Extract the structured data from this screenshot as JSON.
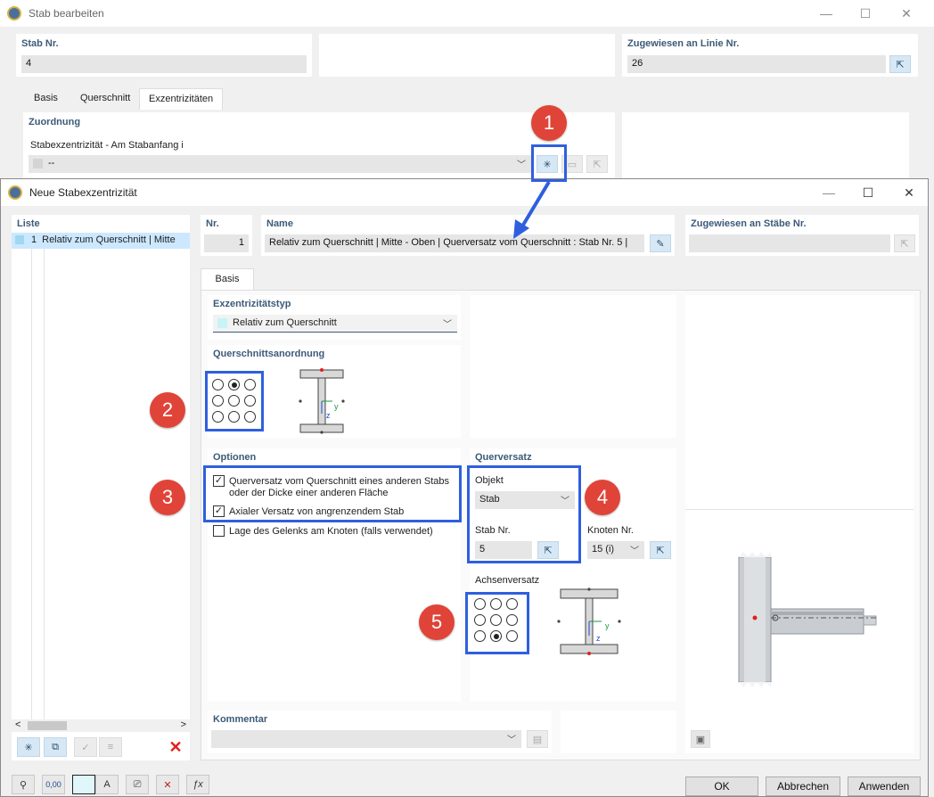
{
  "bg_window": {
    "title": "Stab bearbeiten",
    "stab_nr_label": "Stab Nr.",
    "stab_nr_value": "4",
    "zugewiesen_label": "Zugewiesen an Linie Nr.",
    "zugewiesen_value": "26",
    "tabs": [
      "Basis",
      "Querschnitt",
      "Exzentrizitäten"
    ],
    "zuordnung_label": "Zuordnung",
    "stabanfang_label": "Stabexzentrizität - Am Stabanfang i",
    "stabanfang_value": "--"
  },
  "dialog": {
    "title": "Neue Stabexzentrizität",
    "liste_label": "Liste",
    "liste_items": [
      {
        "nr": "1",
        "text": "Relativ zum Querschnitt | Mitte"
      }
    ],
    "nr_label": "Nr.",
    "nr_value": "1",
    "name_label": "Name",
    "name_value": "Relativ zum Querschnitt | Mitte - Oben | Querversatz vom Querschnitt : Stab Nr. 5 |",
    "zugewiesen_label": "Zugewiesen an Stäbe Nr.",
    "zugewiesen_value": "",
    "tab": "Basis",
    "exz_typ_label": "Exzentrizitätstyp",
    "exz_typ_value": "Relativ zum Querschnitt",
    "qs_anordnung_label": "Querschnittsanordnung",
    "qs_anordnung_selected": 1,
    "optionen_label": "Optionen",
    "options": [
      {
        "text": "Querversatz vom Querschnitt eines anderen Stabs",
        "text2": "oder der Dicke einer anderen Fläche",
        "checked": true
      },
      {
        "text": "Axialer Versatz von angrenzendem Stab",
        "text2": "",
        "checked": true
      },
      {
        "text": "Lage des Gelenks am Knoten (falls verwendet)",
        "text2": "",
        "checked": false
      }
    ],
    "querversatz_label": "Querversatz",
    "objekt_label": "Objekt",
    "objekt_value": "Stab",
    "stab_nr_label": "Stab Nr.",
    "stab_nr_value": "5",
    "knoten_nr_label": "Knoten Nr.",
    "knoten_nr_value": "15 (i)",
    "achsenversatz_label": "Achsenversatz",
    "achsenversatz_selected": 7,
    "kommentar_label": "Kommentar",
    "kommentar_value": "",
    "axis_y": "y",
    "axis_z": "z",
    "ok": "OK",
    "cancel": "Abbrechen",
    "apply": "Anwenden",
    "unit_btn": "0,00"
  },
  "badges": [
    "1",
    "2",
    "3",
    "4",
    "5"
  ],
  "colors": {
    "accent": "#2f5fdf",
    "badge": "#e04438",
    "label": "#3c5a78",
    "selected": "#cce8ff"
  }
}
